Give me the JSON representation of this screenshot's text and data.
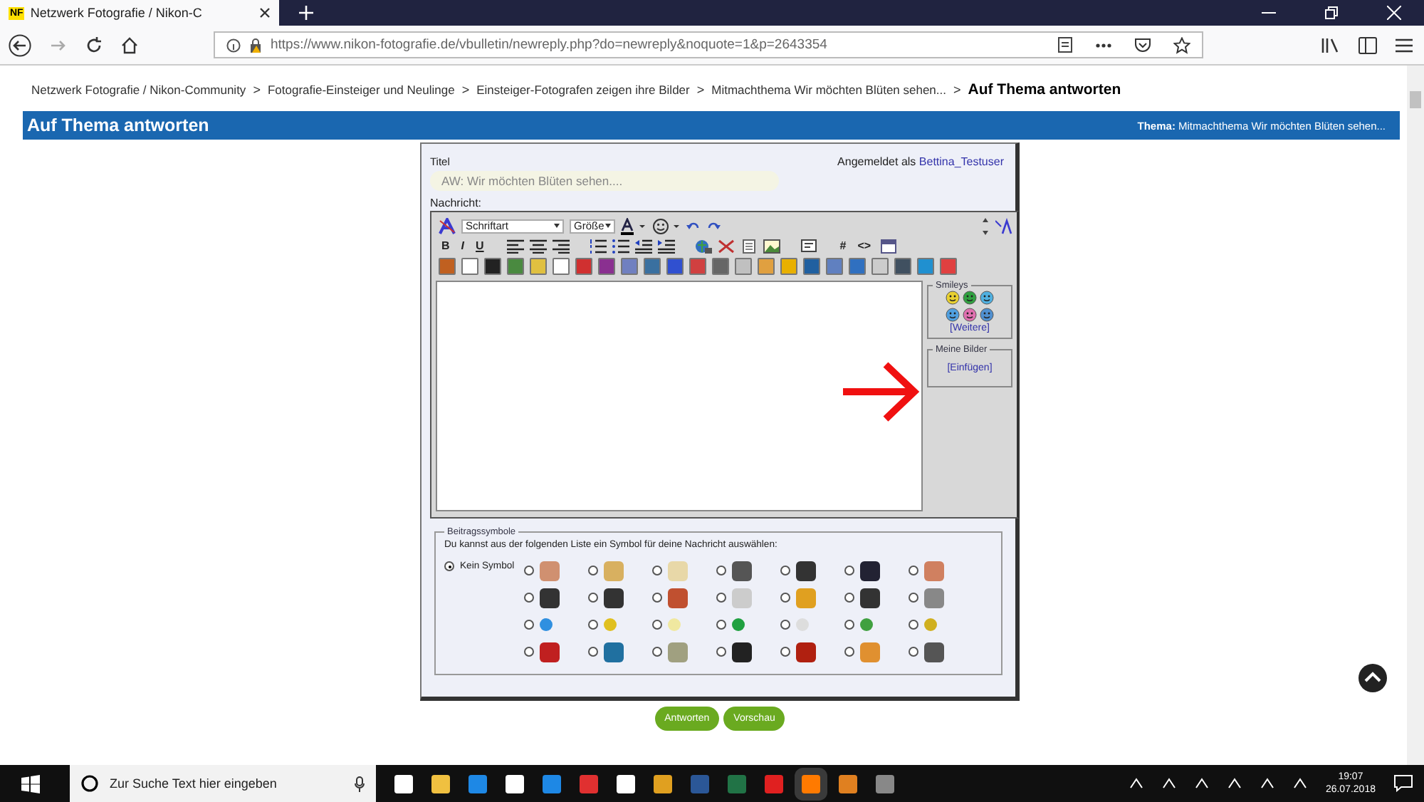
{
  "browser": {
    "tab": {
      "favicon": "NF",
      "title": "Netzwerk Fotografie / Nikon-C",
      "selected": true
    },
    "url": "https://www.nikon-fotografie.de/vbulletin/newreply.php?do=newreply&noquote=1&p=2643354"
  },
  "breadcrumb": {
    "separator": ">",
    "items": [
      {
        "label": "Netzwerk Fotografie / Nikon-Community",
        "kind": "link"
      },
      {
        "label": "Fotografie-Einsteiger und Neulinge",
        "kind": "link"
      },
      {
        "label": "Einsteiger-Fotografen zeigen ihre Bilder",
        "kind": "link"
      },
      {
        "label": "Mitmachthema Wir möchten Blüten sehen...",
        "kind": "link"
      },
      {
        "label": "Auf Thema antworten",
        "kind": "current"
      }
    ]
  },
  "header": {
    "title": "Auf Thema antworten",
    "thread": "**Thema:** Mitmachthema Wir möchten Blüten sehen..."
  },
  "form": {
    "title_label": "Titel",
    "title_value": "AW: Wir möchten Blüten sehen....",
    "logged_in_text": "Angemeldet als",
    "user": "Bettina_Testuser",
    "message_label": "Nachricht:",
    "editor": {
      "font_select": "Schriftart",
      "size_select": "Größe",
      "format_buttons": [
        "B",
        "I",
        "U"
      ],
      "code_buttons": [
        "#",
        "<>"
      ],
      "smileys": {
        "legend": "Smileys",
        "more": "[Weitere]"
      },
      "my_images": {
        "legend": "Meine Bilder",
        "insert": "[Einfügen]"
      }
    },
    "post_icons": {
      "legend": "Beitragssymbole",
      "hint": "Du kannst aus der folgenden Liste ein Symbol für deine Nachricht auswählen:",
      "none_label": "Kein Symbol",
      "options": [
        {
          "selected": true
        },
        {
          "selected": false
        },
        {
          "selected": false
        },
        {
          "selected": false
        },
        {
          "selected": false
        },
        {
          "selected": false
        },
        {
          "selected": false
        },
        {
          "selected": false
        },
        {
          "selected": false
        },
        {
          "selected": false
        },
        {
          "selected": false
        },
        {
          "selected": false
        },
        {
          "selected": false
        },
        {
          "selected": false
        },
        {
          "selected": false
        },
        {
          "selected": false
        },
        {
          "selected": false
        },
        {
          "selected": false
        },
        {
          "selected": false
        },
        {
          "selected": false
        },
        {
          "selected": false
        },
        {
          "selected": false
        },
        {
          "selected": false
        },
        {
          "selected": false
        },
        {
          "selected": false
        },
        {
          "selected": false
        },
        {
          "selected": false
        },
        {
          "selected": false
        },
        {
          "selected": false
        }
      ]
    },
    "buttons": [
      "Antworten",
      "Vorschau"
    ]
  },
  "taskbar": {
    "search_placeholder": "Zur Suche Text hier eingeben",
    "time": "19:07",
    "date": "26.07.2018"
  }
}
